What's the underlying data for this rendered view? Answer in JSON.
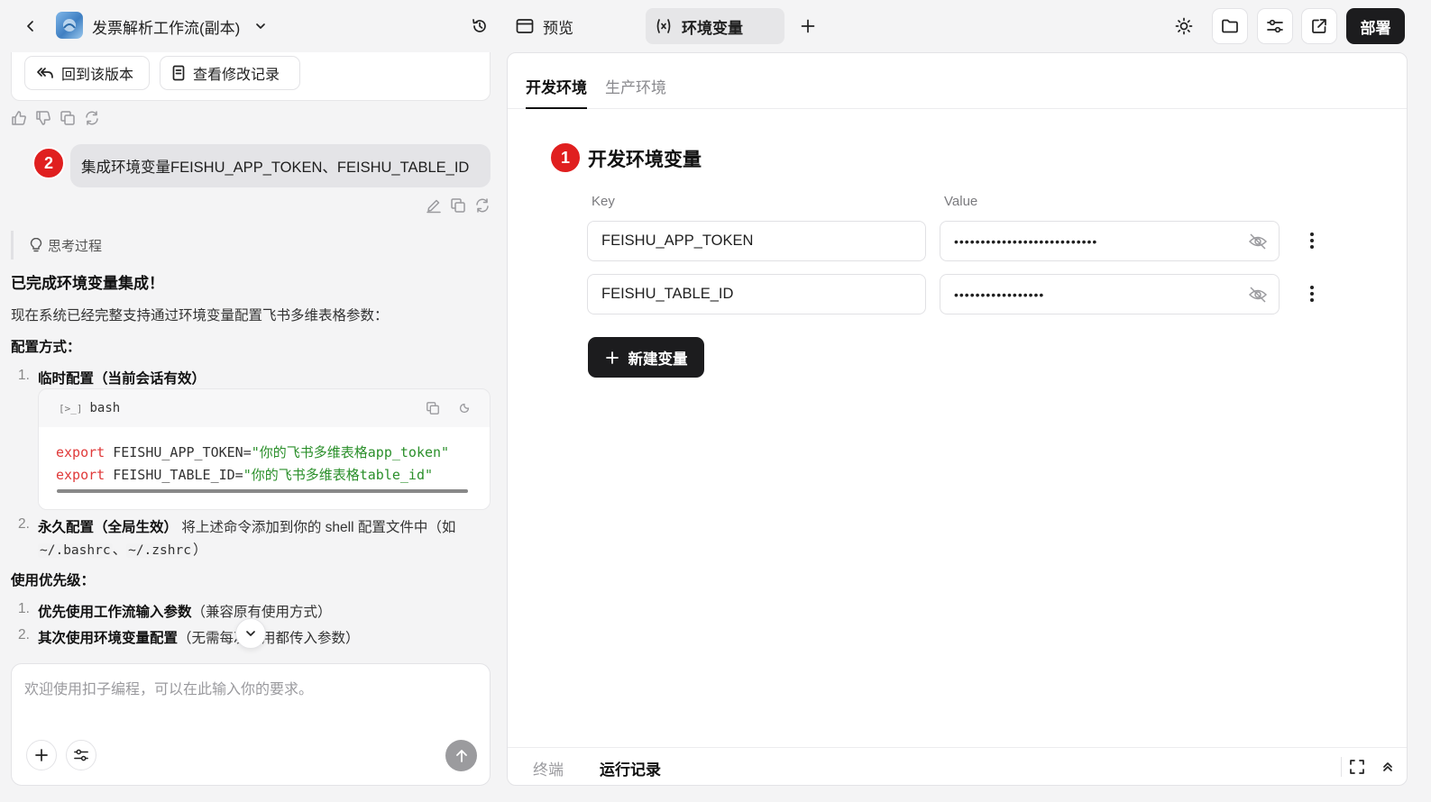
{
  "header": {
    "app_title": "发票解析工作流(副本)",
    "tab_preview": "预览",
    "tab_env": "环境变量",
    "deploy_label": "部署"
  },
  "chat": {
    "revert_label": "回到该版本",
    "changelog_label": "查看修改记录",
    "user_badge": "2",
    "user_message": "集成环境变量FEISHU_APP_TOKEN、FEISHU_TABLE_ID",
    "thinking_label": "思考过程",
    "heading": "已完成环境变量集成！",
    "intro": "现在系统已经完整支持通过环境变量配置飞书多维表格参数：",
    "config_heading": "配置方式：",
    "config_items": [
      {
        "num": "1.",
        "bold": "临时配置（当前会话有效）",
        "rest": ""
      },
      {
        "num": "2.",
        "bold": "永久配置（全局生效）",
        "rest": "将上述命令添加到你的 shell 配置文件中（如"
      }
    ],
    "config_item2_line2": {
      "path1": "~/.bashrc",
      "sep": "、",
      "path2": "~/.zshrc",
      "close": "）"
    },
    "code": {
      "lang": "bash",
      "line1_kw": "export",
      "line1_var": " FEISHU_APP_TOKEN=",
      "line1_str": "\"你的飞书多维表格app_token\"",
      "line2_kw": "export",
      "line2_var": " FEISHU_TABLE_ID=",
      "line2_str": "\"你的飞书多维表格table_id\""
    },
    "priority_heading": "使用优先级：",
    "priority_items": [
      {
        "num": "1.",
        "bold": "优先使用工作流输入参数",
        "rest": "（兼容原有使用方式）"
      },
      {
        "num": "2.",
        "bold": "其次使用环境变量配置",
        "rest": "（无需每次调用都传入参数）"
      }
    ],
    "input_placeholder": "欢迎使用扣子编程，可以在此输入你的要求。"
  },
  "env": {
    "tab_dev": "开发环境",
    "tab_prod": "生产环境",
    "badge": "1",
    "section_title": "开发环境变量",
    "col_key": "Key",
    "col_value": "Value",
    "variables": [
      {
        "key": "FEISHU_APP_TOKEN",
        "value_masked": "•••••••••••••••••••••••••••"
      },
      {
        "key": "FEISHU_TABLE_ID",
        "value_masked": "•••••••••••••••••"
      }
    ],
    "new_var_label": "新建变量"
  },
  "bottom": {
    "terminal_label": "终端",
    "runs_label": "运行记录"
  },
  "colors": {
    "badge_red": "#e01f1f",
    "deploy_bg": "#1c1c1e",
    "code_keyword": "#e03a3a",
    "code_string": "#2a8f2a"
  }
}
